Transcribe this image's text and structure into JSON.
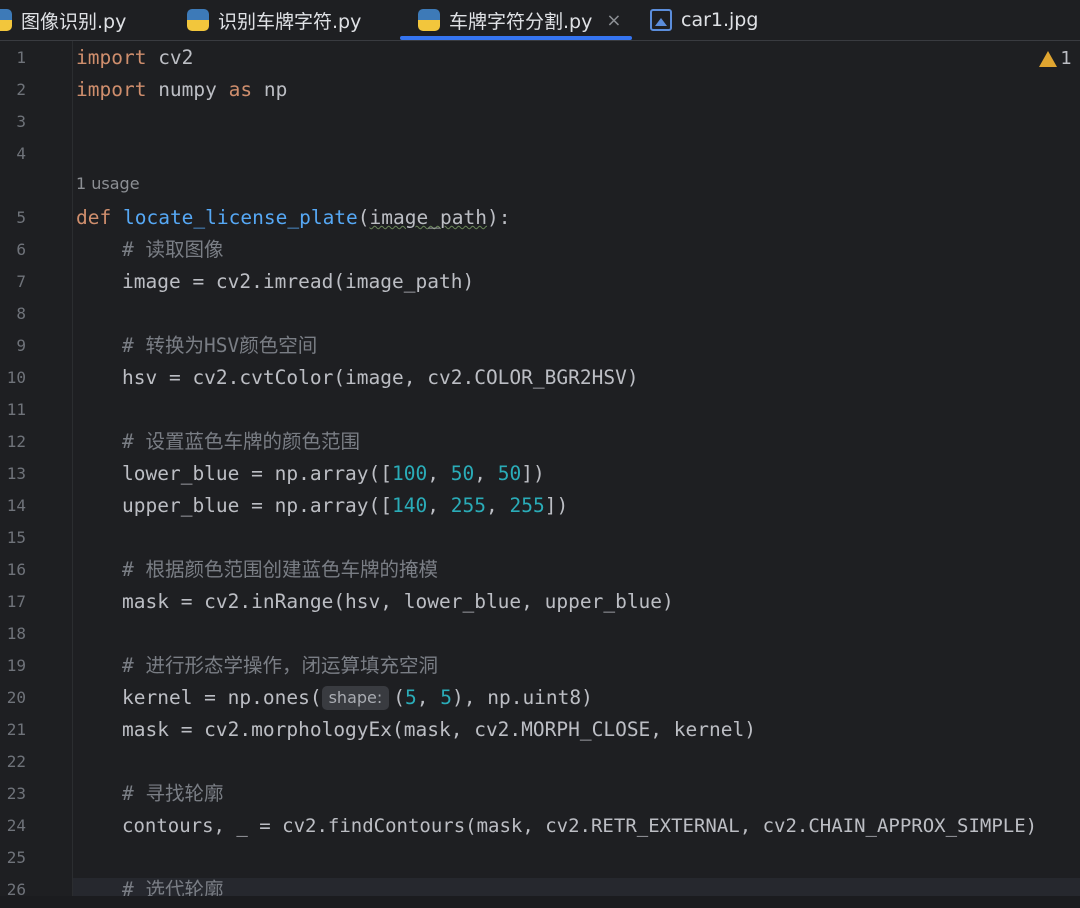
{
  "tabs": [
    {
      "label": "图像识别.py",
      "icon": "python-file-icon"
    },
    {
      "label": "识别车牌字符.py",
      "icon": "python-file-icon"
    },
    {
      "label": "车牌字符分割.py",
      "icon": "python-file-icon",
      "active": true,
      "close": "×"
    },
    {
      "label": "car1.jpg",
      "icon": "image-file-icon"
    }
  ],
  "warnings": {
    "count": "1"
  },
  "inlay": {
    "usage": "1 usage",
    "shape": "shape:"
  },
  "colors": {
    "accent": "#3574f0",
    "keyword": "#cf8e6d",
    "function": "#56a8f5",
    "number": "#2aacb8",
    "comment": "#7a7e85"
  },
  "line_numbers": [
    "1",
    "2",
    "3",
    "4",
    "5",
    "6",
    "7",
    "8",
    "9",
    "10",
    "11",
    "12",
    "13",
    "14",
    "15",
    "16",
    "17",
    "18",
    "19",
    "20",
    "21",
    "22",
    "23",
    "24",
    "25",
    "26"
  ],
  "code": {
    "l1_kw": "import",
    "l1_rest": " cv2",
    "l2_kw": "import",
    "l2_mid": " numpy ",
    "l2_kw2": "as",
    "l2_rest": " np",
    "l5_kw": "def",
    "l5_fn": "locate_license_plate",
    "l5_open": "(",
    "l5_param": "image_path",
    "l5_close": "):",
    "l6": "# 读取图像",
    "l7": "image = cv2.imread(image_path)",
    "l9": "# 转换为HSV颜色空间",
    "l10": "hsv = cv2.cvtColor(image, cv2.COLOR_BGR2HSV)",
    "l12": "# 设置蓝色车牌的颜色范围",
    "l13_a": "lower_blue = np.array([",
    "l13_n1": "100",
    "l13_s1": ", ",
    "l13_n2": "50",
    "l13_s2": ", ",
    "l13_n3": "50",
    "l13_b": "])",
    "l14_a": "upper_blue = np.array([",
    "l14_n1": "140",
    "l14_s1": ", ",
    "l14_n2": "255",
    "l14_s2": ", ",
    "l14_n3": "255",
    "l14_b": "])",
    "l16": "# 根据颜色范围创建蓝色车牌的掩模",
    "l17": "mask = cv2.inRange(hsv, lower_blue, upper_blue)",
    "l19": "# 进行形态学操作，闭运算填充空洞",
    "l20_a": "kernel = np.ones(",
    "l20_b": "(",
    "l20_n1": "5",
    "l20_s": ", ",
    "l20_n2": "5",
    "l20_c": "), np.uint8)",
    "l21": "mask = cv2.morphologyEx(mask, cv2.MORPH_CLOSE, kernel)",
    "l23": "# 寻找轮廓",
    "l24": "contours, _ = cv2.findContours(mask, cv2.RETR_EXTERNAL, cv2.CHAIN_APPROX_SIMPLE)",
    "l26": "# 选代轮廓"
  }
}
